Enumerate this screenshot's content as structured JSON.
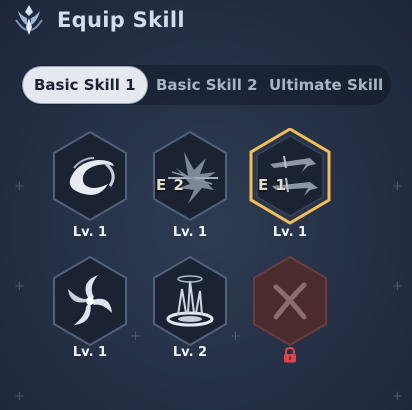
{
  "header": {
    "title": "Equip Skill",
    "logo_icon": "crest-emblem-icon"
  },
  "tabs": [
    {
      "label": "Basic Skill 1",
      "active": true
    },
    {
      "label": "Basic Skill 2",
      "active": false
    },
    {
      "label": "Ultimate Skill",
      "active": false
    }
  ],
  "skills": [
    {
      "icon": "swirl-slash-icon",
      "level": "Lv. 1",
      "badge": "",
      "state": "normal"
    },
    {
      "icon": "shadow-spikes-icon",
      "level": "Lv. 1",
      "badge": "E 2",
      "state": "normal"
    },
    {
      "icon": "twin-blades-icon",
      "level": "Lv. 1",
      "badge": "E 1",
      "state": "selected"
    },
    {
      "icon": "pinwheel-burst-icon",
      "level": "Lv. 1",
      "badge": "",
      "state": "normal"
    },
    {
      "icon": "ground-vortex-icon",
      "level": "Lv. 2",
      "badge": "",
      "state": "normal"
    },
    {
      "icon": "cross-slash-icon",
      "level": "",
      "badge": "",
      "state": "locked"
    }
  ],
  "colors": {
    "selected_border": "#f1bf55",
    "locked_fill": "#4a2b2e",
    "lock": "#e0454f",
    "hex_fill": "#1b2232",
    "hex_border": "#53607a"
  }
}
